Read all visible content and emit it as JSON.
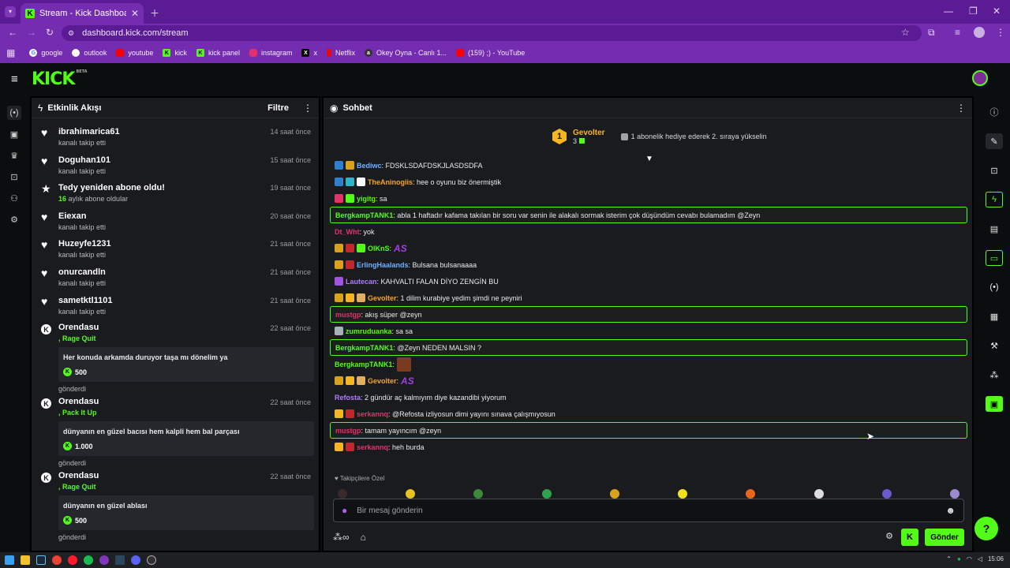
{
  "browser": {
    "tab_title": "Stream - Kick Dashboard",
    "url": "dashboard.kick.com/stream",
    "bookmarks": [
      {
        "label": "google",
        "color": "#ffffff"
      },
      {
        "label": "outlook",
        "color": "#ffffff"
      },
      {
        "label": "youtube",
        "color": "#ff0000"
      },
      {
        "label": "kick",
        "color": "#53fc18"
      },
      {
        "label": "kick panel",
        "color": "#53fc18"
      },
      {
        "label": "instagram",
        "color": "#e1306c"
      },
      {
        "label": "x",
        "color": "#000000"
      },
      {
        "label": "Netflix",
        "color": "#e50914"
      },
      {
        "label": "Okey Oyna - Canlı 1...",
        "color": "#333333"
      },
      {
        "label": "(159) ;) - YouTube",
        "color": "#ff0000"
      }
    ]
  },
  "header": {
    "logo": "KICK",
    "logo_sup": "BETA"
  },
  "activity": {
    "title": "Etkinlik Akışı",
    "filter": "Filtre",
    "follows": [
      {
        "name": "ibrahimarica61",
        "action": "kanalı takip etti",
        "time": "14 saat önce"
      },
      {
        "name": "Doguhan101",
        "action": "kanalı takip etti",
        "time": "15 saat önce"
      },
      {
        "name": "Tedy yeniden abone oldu!",
        "count": "16",
        "action": " aylık abone oldular",
        "time": "19 saat önce"
      },
      {
        "name": "Eiexan",
        "action": "kanalı takip etti",
        "time": "20 saat önce"
      },
      {
        "name": "Huzeyfe1231",
        "action": "kanalı takip etti",
        "time": "21 saat önce"
      },
      {
        "name": "onurcandln",
        "action": "kanalı takip etti",
        "time": "21 saat önce"
      },
      {
        "name": "sametktl1101",
        "action": "kanalı takip etti",
        "time": "21 saat önce"
      }
    ],
    "redeems": [
      {
        "name": "Orendasu",
        "reward": ", Rage Quit",
        "message": "Her konuda arkamda duruyor taşa mı dönelim ya",
        "amount": "500",
        "sent": "gönderdi",
        "time": "22 saat önce"
      },
      {
        "name": "Orendasu",
        "reward": ", Pack It Up",
        "message": "dünyanın en güzel bacısı hem kalpli hem bal parçası",
        "amount": "1.000",
        "sent": "gönderdi",
        "time": "22 saat önce"
      },
      {
        "name": "Orendasu",
        "reward": ", Rage Quit",
        "message": "dünyanın en güzel ablası",
        "amount": "500",
        "sent": "gönderdi",
        "time": "22 saat önce"
      }
    ]
  },
  "chat": {
    "title": "Sohbet",
    "pinned": {
      "rank": "1",
      "user": "Gevolter",
      "count": "3",
      "text": "1 abonelik hediye ederek 2. sıraya yükselin"
    },
    "messages": [
      {
        "user": "Bediwc",
        "color": "#6fb1ff",
        "text": ": FDSKLSDAFDSKJLASDSDFA",
        "badges": [
          "#2f7fd0",
          "#d9a21b"
        ],
        "hl": false
      },
      {
        "user": "TheAninogiis",
        "color": "#f6a623",
        "text": ": hee o oyunu biz önermiştik",
        "badges": [
          "#2f7fd0",
          "#2fb3c9",
          "#ffffff"
        ],
        "hl": false
      },
      {
        "user": "yigitg",
        "color": "#53fc18",
        "text": ": sa",
        "badges": [
          "#e2336b",
          "#53fc18"
        ],
        "hl": false
      },
      {
        "user": "BergkampTANK1",
        "color": "#53fc18",
        "text": ": abla 1 haftadır kafama takılan bir soru var senin ile alakalı sormak isterim çok düşündüm cevabı bulamadım @Zeyn",
        "badges": [],
        "hl": true
      },
      {
        "user": "Dt_Wht",
        "color": "#e2336b",
        "text": ": yok",
        "badges": [],
        "hl": false
      },
      {
        "user": "OlKnS",
        "color": "#53fc18",
        "text": ":",
        "emote": "AS",
        "badges": [
          "#d9a21b",
          "#c0282d",
          "#53fc18"
        ],
        "hl": false
      },
      {
        "user": "ErlingHaalands",
        "color": "#6fb1ff",
        "text": ": Bulsana bulsanaaaa",
        "badges": [
          "#d9a21b",
          "#c0282d"
        ],
        "hl": false
      },
      {
        "user": "Lautecan",
        "color": "#b07bff",
        "text": ": KAHVALTI FALAN DİYO ZENGİN BU",
        "badges": [
          "#a055e0"
        ],
        "hl": false
      },
      {
        "user": "Gevolter",
        "color": "#f6a623",
        "text": ": 1 dilim kurabiye yedim şimdi ne peyniri",
        "badges": [
          "#d9a21b",
          "#f6b624",
          "#e0b060"
        ],
        "hl": false
      },
      {
        "user": "mustgp",
        "color": "#e2336b",
        "text": ": akış süper @zeyn",
        "badges": [],
        "hl": true
      },
      {
        "user": "zumruduanka",
        "color": "#53fc18",
        "text": ": sa sa",
        "badges": [
          "#a8b0b8"
        ],
        "hl": false
      },
      {
        "user": "BergkampTANK1",
        "color": "#53fc18",
        "text": ": @Zeyn NEDEN MALSIN ?",
        "badges": [],
        "hl": true
      },
      {
        "user": "BergkampTANK1",
        "color": "#53fc18",
        "text": ":",
        "img": true,
        "badges": [],
        "hl": false
      },
      {
        "user": "Gevolter",
        "color": "#f6a623",
        "text": ":",
        "emote": "AS",
        "badges": [
          "#d9a21b",
          "#f6b624",
          "#e0b060"
        ],
        "hl": false
      },
      {
        "user": "Refosta",
        "color": "#b07bff",
        "text": ": 2 gündür aç kalmıyım diye kazandibi yiyorum",
        "badges": [],
        "hl": false
      },
      {
        "user": "serkannq",
        "color": "#e2336b",
        "text": ": @Refosta izliyosun dimi yayını sınava çalışmıyosun",
        "badges": [
          "#f6b624",
          "#c0282d"
        ],
        "hl": false
      },
      {
        "user": "mustgp",
        "color": "#e2336b",
        "text": ": tamam yayıncım @zeyn",
        "badges": [],
        "hl": true
      },
      {
        "user": "serkannq",
        "color": "#e2336b",
        "text": ": heh burda",
        "badges": [
          "#f6b624",
          "#c0282d"
        ],
        "hl": false
      }
    ],
    "followers_only_label": "Takipçilere Özel",
    "emote_colors": [
      "#3a2a2a",
      "#e8c220",
      "#3a8a3a",
      "#2ea34a",
      "#d9a21b",
      "#f3e21a",
      "#e8651a",
      "#dddddd",
      "#6a5acd",
      "#9b8ad0"
    ],
    "input_placeholder": "Bir mesaj gönderin",
    "send_label": "Gönder",
    "infinity": "∞"
  },
  "taskbar": {
    "time": "15:06"
  }
}
